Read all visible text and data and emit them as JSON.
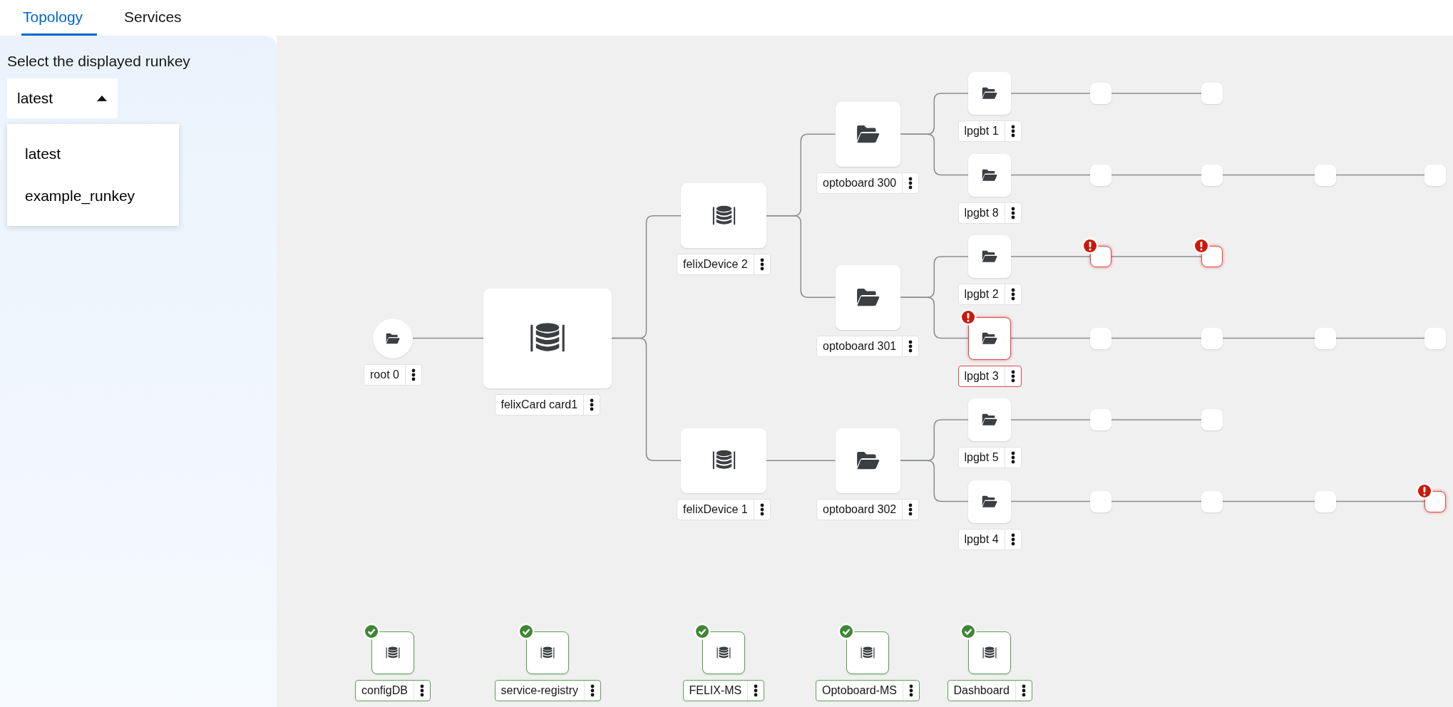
{
  "tabs": [
    {
      "label": "Topology",
      "selected": true
    },
    {
      "label": "Services",
      "selected": false
    }
  ],
  "runkey_select": {
    "label": "Select the displayed runkey",
    "value": "latest",
    "expanded": true,
    "options": [
      {
        "label": "latest"
      },
      {
        "label": "example_runkey"
      }
    ]
  },
  "topology": {
    "label": "root 0",
    "kind": "folder",
    "error": false,
    "children": [
      {
        "label": "felixCard card1",
        "kind": "database",
        "error": false,
        "children": [
          {
            "label": "felixDevice 2",
            "kind": "database",
            "error": false,
            "children": [
              {
                "label": "optoboard 300",
                "kind": "folder",
                "error": false,
                "children": [
                  {
                    "label": "lpgbt 1",
                    "kind": "folder",
                    "error": false,
                    "children": [
                      {
                        "kind": "blank",
                        "error": false,
                        "children": [
                          {
                            "kind": "blank",
                            "error": false
                          }
                        ]
                      }
                    ]
                  },
                  {
                    "label": "lpgbt 8",
                    "kind": "folder",
                    "error": false,
                    "children": [
                      {
                        "kind": "blank",
                        "error": false,
                        "children": [
                          {
                            "kind": "blank",
                            "error": false,
                            "children": [
                              {
                                "kind": "blank",
                                "error": false,
                                "children": [
                                  {
                                    "kind": "blank",
                                    "error": false
                                  }
                                ]
                              }
                            ]
                          }
                        ]
                      }
                    ]
                  }
                ]
              },
              {
                "label": "optoboard 301",
                "kind": "folder",
                "error": false,
                "children": [
                  {
                    "label": "lpgbt 2",
                    "kind": "folder",
                    "error": false,
                    "children": [
                      {
                        "kind": "blank",
                        "error": true,
                        "children": [
                          {
                            "kind": "blank",
                            "error": true
                          }
                        ]
                      }
                    ]
                  },
                  {
                    "label": "lpgbt 3",
                    "kind": "folder",
                    "error": true,
                    "children": [
                      {
                        "kind": "blank",
                        "error": false,
                        "children": [
                          {
                            "kind": "blank",
                            "error": false,
                            "children": [
                              {
                                "kind": "blank",
                                "error": false,
                                "children": [
                                  {
                                    "kind": "blank",
                                    "error": false
                                  }
                                ]
                              }
                            ]
                          }
                        ]
                      }
                    ]
                  }
                ]
              }
            ]
          },
          {
            "label": "felixDevice 1",
            "kind": "database",
            "error": false,
            "children": [
              {
                "label": "optoboard 302",
                "kind": "folder",
                "error": false,
                "children": [
                  {
                    "label": "lpgbt 5",
                    "kind": "folder",
                    "error": false,
                    "children": [
                      {
                        "kind": "blank",
                        "error": false,
                        "children": [
                          {
                            "kind": "blank",
                            "error": false
                          }
                        ]
                      }
                    ]
                  },
                  {
                    "label": "lpgbt 4",
                    "kind": "folder",
                    "error": false,
                    "children": [
                      {
                        "kind": "blank",
                        "error": false,
                        "children": [
                          {
                            "kind": "blank",
                            "error": false,
                            "children": [
                              {
                                "kind": "blank",
                                "error": false,
                                "children": [
                                  {
                                    "kind": "blank",
                                    "error": true
                                  }
                                ]
                              }
                            ]
                          }
                        ]
                      }
                    ]
                  }
                ]
              }
            ]
          }
        ]
      }
    ]
  },
  "services": [
    {
      "label": "configDB",
      "kind": "database",
      "healthy": true
    },
    {
      "label": "service-registry",
      "kind": "database",
      "healthy": true
    },
    {
      "label": "FELIX-MS",
      "kind": "database",
      "healthy": true
    },
    {
      "label": "Optoboard-MS",
      "kind": "database",
      "healthy": true
    },
    {
      "label": "Dashboard",
      "kind": "database",
      "healthy": true
    }
  ]
}
